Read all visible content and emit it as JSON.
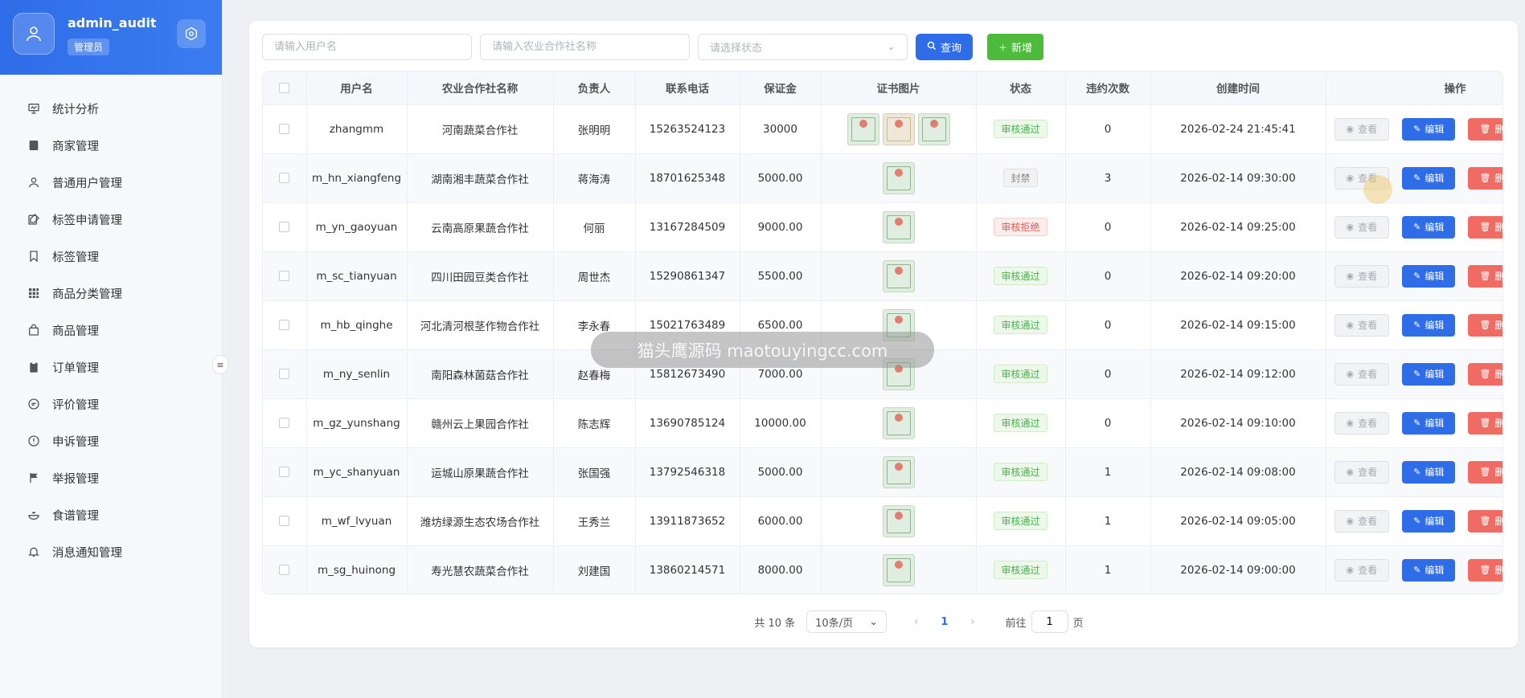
{
  "user": {
    "name": "admin_audit",
    "role": "管理员"
  },
  "sidebar": {
    "items": [
      {
        "label": "统计分析",
        "icon": "chart-board-icon"
      },
      {
        "label": "商家管理",
        "icon": "book-icon"
      },
      {
        "label": "普通用户管理",
        "icon": "user-icon"
      },
      {
        "label": "标签申请管理",
        "icon": "edit-icon"
      },
      {
        "label": "标签管理",
        "icon": "bookmark-icon"
      },
      {
        "label": "商品分类管理",
        "icon": "grid-icon"
      },
      {
        "label": "商品管理",
        "icon": "bag-icon"
      },
      {
        "label": "订单管理",
        "icon": "clipboard-icon"
      },
      {
        "label": "评价管理",
        "icon": "chat-icon"
      },
      {
        "label": "申诉管理",
        "icon": "warning-circle-icon"
      },
      {
        "label": "举报管理",
        "icon": "flag-icon"
      },
      {
        "label": "食谱管理",
        "icon": "bowl-icon"
      },
      {
        "label": "消息通知管理",
        "icon": "bell-icon"
      }
    ]
  },
  "filters": {
    "username_placeholder": "请输入用户名",
    "coop_placeholder": "请输入农业合作社名称",
    "status_placeholder": "请选择状态",
    "query_label": "查询",
    "add_label": "新增"
  },
  "table": {
    "headers": [
      "用户名",
      "农业合作社名称",
      "负责人",
      "联系电话",
      "保证金",
      "证书图片",
      "状态",
      "违约次数",
      "创建时间",
      "操作"
    ],
    "rows": [
      {
        "username": "zhangmm",
        "coop": "河南蔬菜合作社",
        "owner": "张明明",
        "phone": "15263524123",
        "deposit": "30000",
        "certs": 3,
        "status": "审核通过",
        "status_type": "pass",
        "violations": "0",
        "created": "2026-02-24 21:45:41"
      },
      {
        "username": "m_hn_xiangfeng",
        "coop": "湖南湘丰蔬菜合作社",
        "owner": "蒋海涛",
        "phone": "18701625348",
        "deposit": "5000.00",
        "certs": 1,
        "status": "封禁",
        "status_type": "ban",
        "violations": "3",
        "created": "2026-02-14 09:30:00"
      },
      {
        "username": "m_yn_gaoyuan",
        "coop": "云南高原果蔬合作社",
        "owner": "何丽",
        "phone": "13167284509",
        "deposit": "9000.00",
        "certs": 1,
        "status": "审核拒绝",
        "status_type": "reject",
        "violations": "0",
        "created": "2026-02-14 09:25:00"
      },
      {
        "username": "m_sc_tianyuan",
        "coop": "四川田园豆类合作社",
        "owner": "周世杰",
        "phone": "15290861347",
        "deposit": "5500.00",
        "certs": 1,
        "status": "审核通过",
        "status_type": "pass",
        "violations": "0",
        "created": "2026-02-14 09:20:00"
      },
      {
        "username": "m_hb_qinghe",
        "coop": "河北清河根茎作物合作社",
        "owner": "李永春",
        "phone": "15021763489",
        "deposit": "6500.00",
        "certs": 1,
        "status": "审核通过",
        "status_type": "pass",
        "violations": "0",
        "created": "2026-02-14 09:15:00"
      },
      {
        "username": "m_ny_senlin",
        "coop": "南阳森林菌菇合作社",
        "owner": "赵春梅",
        "phone": "15812673490",
        "deposit": "7000.00",
        "certs": 1,
        "status": "审核通过",
        "status_type": "pass",
        "violations": "0",
        "created": "2026-02-14 09:12:00"
      },
      {
        "username": "m_gz_yunshang",
        "coop": "赣州云上果园合作社",
        "owner": "陈志辉",
        "phone": "13690785124",
        "deposit": "10000.00",
        "certs": 1,
        "status": "审核通过",
        "status_type": "pass",
        "violations": "0",
        "created": "2026-02-14 09:10:00"
      },
      {
        "username": "m_yc_shanyuan",
        "coop": "运城山原果蔬合作社",
        "owner": "张国强",
        "phone": "13792546318",
        "deposit": "5000.00",
        "certs": 1,
        "status": "审核通过",
        "status_type": "pass",
        "violations": "1",
        "created": "2026-02-14 09:08:00"
      },
      {
        "username": "m_wf_lvyuan",
        "coop": "潍坊绿源生态农场合作社",
        "owner": "王秀兰",
        "phone": "13911873652",
        "deposit": "6000.00",
        "certs": 1,
        "status": "审核通过",
        "status_type": "pass",
        "violations": "1",
        "created": "2026-02-14 09:05:00"
      },
      {
        "username": "m_sg_huinong",
        "coop": "寿光慧农蔬菜合作社",
        "owner": "刘建国",
        "phone": "13860214571",
        "deposit": "8000.00",
        "certs": 1,
        "status": "审核通过",
        "status_type": "pass",
        "violations": "1",
        "created": "2026-02-14 09:00:00"
      }
    ],
    "actions": {
      "view": "查看",
      "edit": "编辑",
      "delete": "删除"
    }
  },
  "pagination": {
    "total": "共 10 条",
    "page_size": "10条/页",
    "current_page": "1",
    "goto_prefix": "前往",
    "goto_value": "1",
    "goto_suffix": "页"
  },
  "watermark": "猫头鹰源码 maotouyingcc.com",
  "colors": {
    "primary": "#2f6de8",
    "success": "#4fbb3c",
    "danger": "#ef6b63"
  }
}
